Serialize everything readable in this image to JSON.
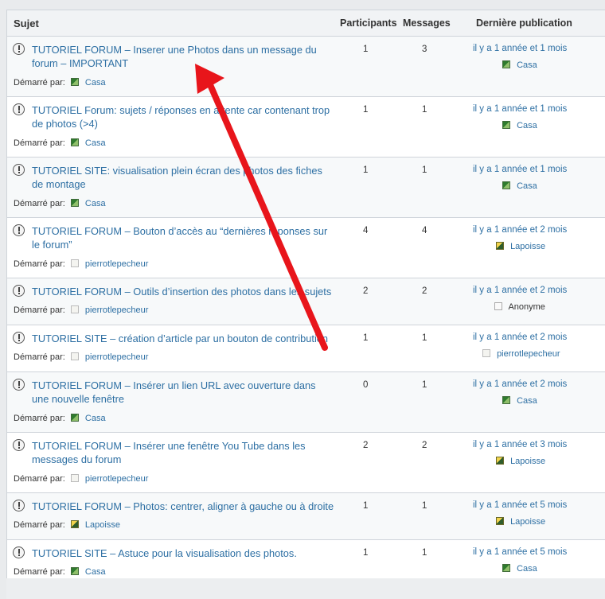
{
  "header": {
    "subject": "Sujet",
    "participants": "Participants",
    "messages": "Messages",
    "last_post": "Dernière publication"
  },
  "started_by_label": "Démarré par:",
  "topics": [
    {
      "title": "TUTORIEL FORUM – Inserer une Photos dans un message du forum – IMPORTANT",
      "starter": "Casa",
      "starter_avatar": "green",
      "participants": "1",
      "messages": "3",
      "last_time": "il y a 1 année et 1 mois",
      "last_user": "Casa",
      "last_avatar": "green"
    },
    {
      "title": "TUTORIEL Forum: sujets / réponses en attente car contenant trop de photos (>4)",
      "starter": "Casa",
      "starter_avatar": "green",
      "participants": "1",
      "messages": "1",
      "last_time": "il y a 1 année et 1 mois",
      "last_user": "Casa",
      "last_avatar": "green"
    },
    {
      "title": "TUTORIEL SITE: visualisation plein écran des photos des fiches de montage",
      "starter": "Casa",
      "starter_avatar": "green",
      "participants": "1",
      "messages": "1",
      "last_time": "il y a 1 année et 1 mois",
      "last_user": "Casa",
      "last_avatar": "green"
    },
    {
      "title": "TUTORIEL FORUM – Bouton d’accès au “dernières réponses sur le forum”",
      "starter": "pierrotlepecheur",
      "starter_avatar": "light",
      "participants": "4",
      "messages": "4",
      "last_time": "il y a 1 année et 2 mois",
      "last_user": "Lapoisse",
      "last_avatar": "yellow"
    },
    {
      "title": "TUTORIEL FORUM – Outils d’insertion des photos dans les sujets",
      "starter": "pierrotlepecheur",
      "starter_avatar": "light",
      "participants": "2",
      "messages": "2",
      "last_time": "il y a 1 année et 2 mois",
      "last_user": "Anonyme",
      "last_avatar": "grey"
    },
    {
      "title": "TUTORIEL SITE – création d’article par un bouton de contribution",
      "starter": "pierrotlepecheur",
      "starter_avatar": "light",
      "participants": "1",
      "messages": "1",
      "last_time": "il y a 1 année et 2 mois",
      "last_user": "pierrotlepecheur",
      "last_avatar": "light"
    },
    {
      "title": "TUTORIEL FORUM – Insérer un lien URL avec ouverture dans une nouvelle fenêtre",
      "starter": "Casa",
      "starter_avatar": "green",
      "participants": "0",
      "messages": "1",
      "last_time": "il y a 1 année et 2 mois",
      "last_user": "Casa",
      "last_avatar": "green"
    },
    {
      "title": "TUTORIEL FORUM – Insérer une fenêtre You Tube dans les messages du forum",
      "starter": "pierrotlepecheur",
      "starter_avatar": "light",
      "participants": "2",
      "messages": "2",
      "last_time": "il y a 1 année et 3 mois",
      "last_user": "Lapoisse",
      "last_avatar": "yellow"
    },
    {
      "title": "TUTORIEL FORUM – Photos: centrer, aligner à gauche ou à droite",
      "starter": "Lapoisse",
      "starter_avatar": "yellow",
      "participants": "1",
      "messages": "1",
      "last_time": "il y a 1 année et 5 mois",
      "last_user": "Lapoisse",
      "last_avatar": "yellow"
    },
    {
      "title": "TUTORIEL SITE – Astuce pour la visualisation des photos.",
      "starter": "Casa",
      "starter_avatar": "green",
      "participants": "1",
      "messages": "1",
      "last_time": "il y a 1 année et 5 mois",
      "last_user": "Casa",
      "last_avatar": "green"
    }
  ],
  "colors": {
    "link": "#2d6fa3",
    "arrow": "#e8151b",
    "header_bg": "#f1f3f5",
    "alt_row": "#f7f9fa"
  }
}
